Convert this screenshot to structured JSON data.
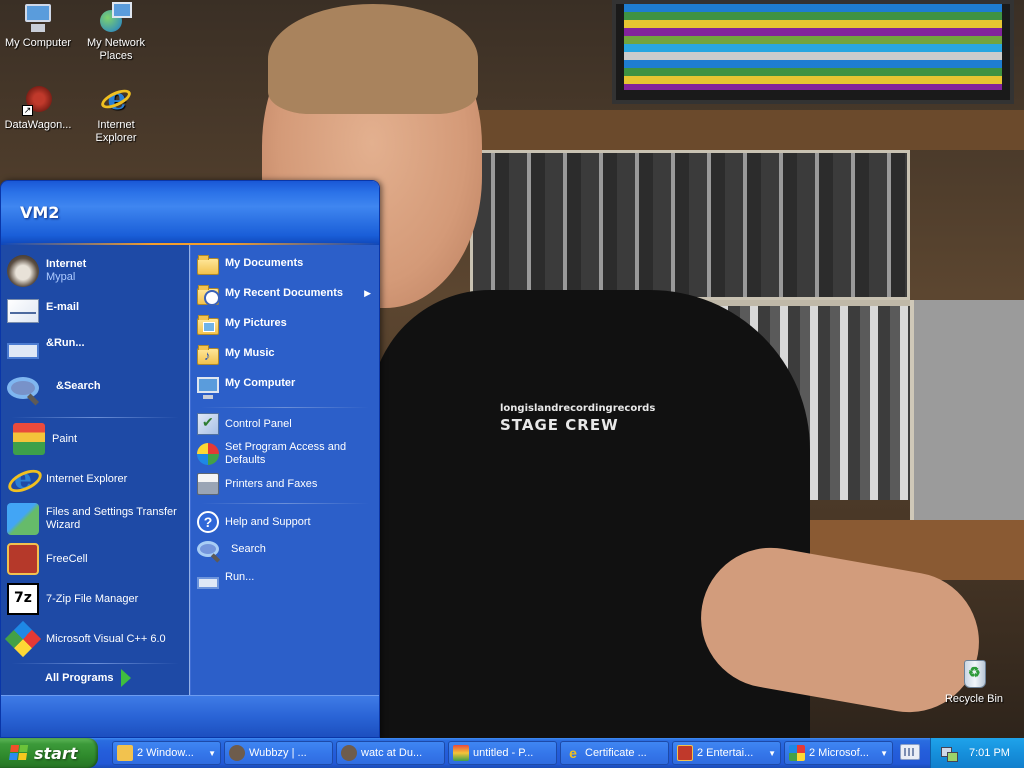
{
  "desktop": {
    "icons": [
      {
        "label": "My Computer",
        "icon": "my-computer-icon"
      },
      {
        "label": "My Network Places",
        "icon": "network-places-icon"
      },
      {
        "label": "DataWagon...",
        "icon": "datawagon-icon"
      },
      {
        "label": "Internet Explorer",
        "icon": "internet-explorer-icon"
      },
      {
        "label": "Recycle Bin",
        "icon": "recycle-bin-icon"
      }
    ],
    "wallpaper": {
      "shirt_text_top": "longislandrecordingrecords",
      "shirt_text_big": "STAGE CREW"
    }
  },
  "start_menu": {
    "user_name": "VM2",
    "pinned": [
      {
        "title": "Internet",
        "subtitle": "Mypal",
        "icon": "raccoon-icon"
      },
      {
        "title": "E-mail",
        "icon": "email-icon"
      },
      {
        "title": "&Run...",
        "icon": "run-icon"
      },
      {
        "title": "&Search",
        "icon": "search-icon"
      }
    ],
    "recent_programs": [
      {
        "label": "Paint",
        "icon": "paint-icon"
      },
      {
        "label": "Internet Explorer",
        "icon": "internet-explorer-icon"
      },
      {
        "label": "Files and Settings Transfer Wizard",
        "icon": "transfer-wizard-icon"
      },
      {
        "label": "FreeCell",
        "icon": "freecell-icon"
      },
      {
        "label": "7-Zip File Manager",
        "icon": "7zip-icon",
        "icon_text": "7z"
      },
      {
        "label": "Microsoft Visual C++ 6.0",
        "icon": "visual-cpp-icon"
      }
    ],
    "all_programs_label": "All Programs",
    "places": [
      {
        "label": "My Documents",
        "icon": "folder-icon"
      },
      {
        "label": "My Recent Documents",
        "icon": "recent-documents-icon",
        "has_submenu": true
      },
      {
        "label": "My Pictures",
        "icon": "pictures-folder-icon"
      },
      {
        "label": "My Music",
        "icon": "music-folder-icon"
      },
      {
        "label": "My Computer",
        "icon": "my-computer-icon"
      }
    ],
    "system": [
      {
        "label": "Control Panel",
        "icon": "control-panel-icon"
      },
      {
        "label": "Set Program Access and Defaults",
        "icon": "program-access-icon"
      },
      {
        "label": "Printers and Faxes",
        "icon": "printer-icon"
      }
    ],
    "help": [
      {
        "label": "Help and Support",
        "icon": "help-icon",
        "icon_text": "?"
      },
      {
        "label": "Search",
        "icon": "search-icon"
      },
      {
        "label": "Run...",
        "icon": "run-icon"
      }
    ]
  },
  "taskbar": {
    "start_label": "start",
    "buttons": [
      {
        "label": "2 Window...",
        "icon": "folder-icon",
        "grouped": true
      },
      {
        "label": "Wubbzy | ...",
        "icon": "raccoon-icon",
        "grouped": false
      },
      {
        "label": "watc at Du...",
        "icon": "raccoon-icon",
        "grouped": false
      },
      {
        "label": "untitled - P...",
        "icon": "paint-icon",
        "grouped": false
      },
      {
        "label": "Certificate ...",
        "icon": "internet-explorer-icon",
        "grouped": false
      },
      {
        "label": "2 Entertai...",
        "icon": "entertainment-icon",
        "grouped": true
      },
      {
        "label": "2 Microsof...",
        "icon": "visual-cpp-icon",
        "grouped": true
      }
    ],
    "clock": "7:01 PM"
  },
  "colors": {
    "start_menu_left": "#1e4aa6",
    "start_menu_right": "#2c5fc9",
    "taskbar_blue": "#245edb",
    "start_green": "#3c9a3a",
    "tray_blue": "#1690dc"
  }
}
